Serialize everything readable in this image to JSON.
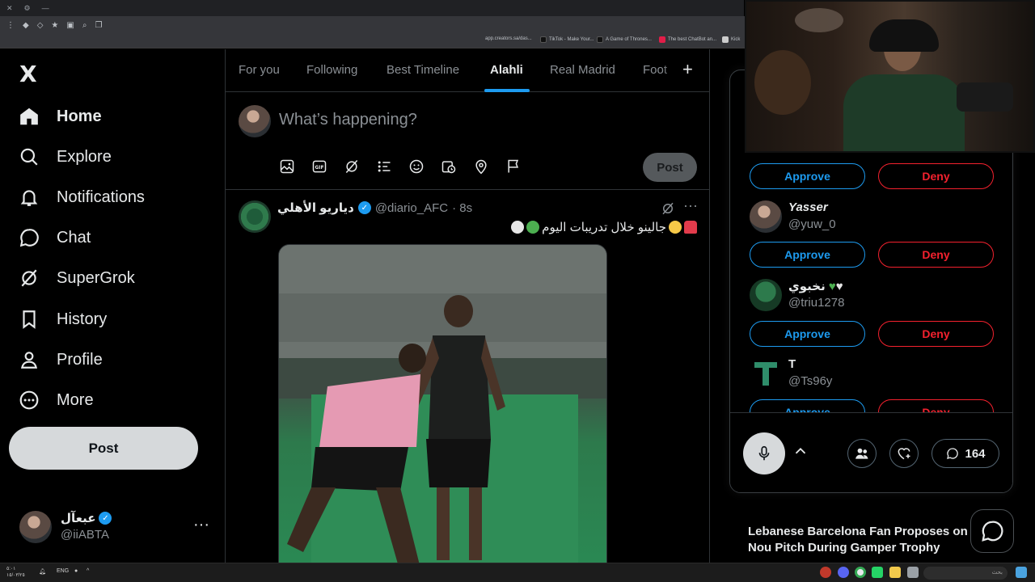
{
  "browser": {
    "bookmarks": [
      {
        "label": "app.creators.sa/das...",
        "color": "#3b82f6"
      },
      {
        "label": "TikTok - Make Your...",
        "color": "#111111"
      },
      {
        "label": "A Game of Thrones...",
        "color": "#111111"
      },
      {
        "label": "The best ChatBot an...",
        "color": "#e11d48"
      },
      {
        "label": "Kick",
        "color": "#53fc18"
      }
    ]
  },
  "sidebar": {
    "logo": "X",
    "items": [
      {
        "label": "Home",
        "icon": "home-icon",
        "active": true
      },
      {
        "label": "Explore",
        "icon": "search-icon"
      },
      {
        "label": "Notifications",
        "icon": "bell-icon"
      },
      {
        "label": "Chat",
        "icon": "chat-bubble-icon"
      },
      {
        "label": "SuperGrok",
        "icon": "grok-icon"
      },
      {
        "label": "History",
        "icon": "bookmark-icon"
      },
      {
        "label": "Profile",
        "icon": "person-icon"
      },
      {
        "label": "More",
        "icon": "more-circle-icon"
      }
    ],
    "post_label": "Post",
    "account": {
      "name": "عبعآل",
      "handle": "@iiABTA"
    }
  },
  "main": {
    "tabs": [
      {
        "label": "For you"
      },
      {
        "label": "Following"
      },
      {
        "label": "Best Timeline"
      },
      {
        "label": "Alahli",
        "active": true
      },
      {
        "label": "Real Madrid"
      },
      {
        "label": "Foot"
      }
    ],
    "composer": {
      "placeholder": "What’s happening?",
      "post_label": "Post"
    },
    "tweet": {
      "name": "دياريو الأهلي",
      "handle": "@diario_AFC",
      "time": "· 8s",
      "text": "جالينو خلال تدريبات اليوم"
    }
  },
  "spaces": {
    "approve_label": "Approve",
    "deny_label": "Deny",
    "requests": [
      {
        "name": "Yasser",
        "handle": "@yuw_0"
      },
      {
        "name": "نخبوي",
        "handle": "@triu1278"
      },
      {
        "name": "T",
        "handle": "@Ts96y"
      }
    ],
    "comment_count": "164"
  },
  "right": {
    "trend_title": "Lebanese Barcelona Fan Proposes on Nou Pitch During Gamper Trophy"
  },
  "taskbar": {
    "clock_time": "٥:٠١",
    "clock_date": "١٥/٠٣/٢٥",
    "lang": "ENG",
    "search_placeholder": "بحث"
  },
  "colors": {
    "accent": "#1d9bf0",
    "danger": "#f4212e",
    "bg": "#000000"
  }
}
